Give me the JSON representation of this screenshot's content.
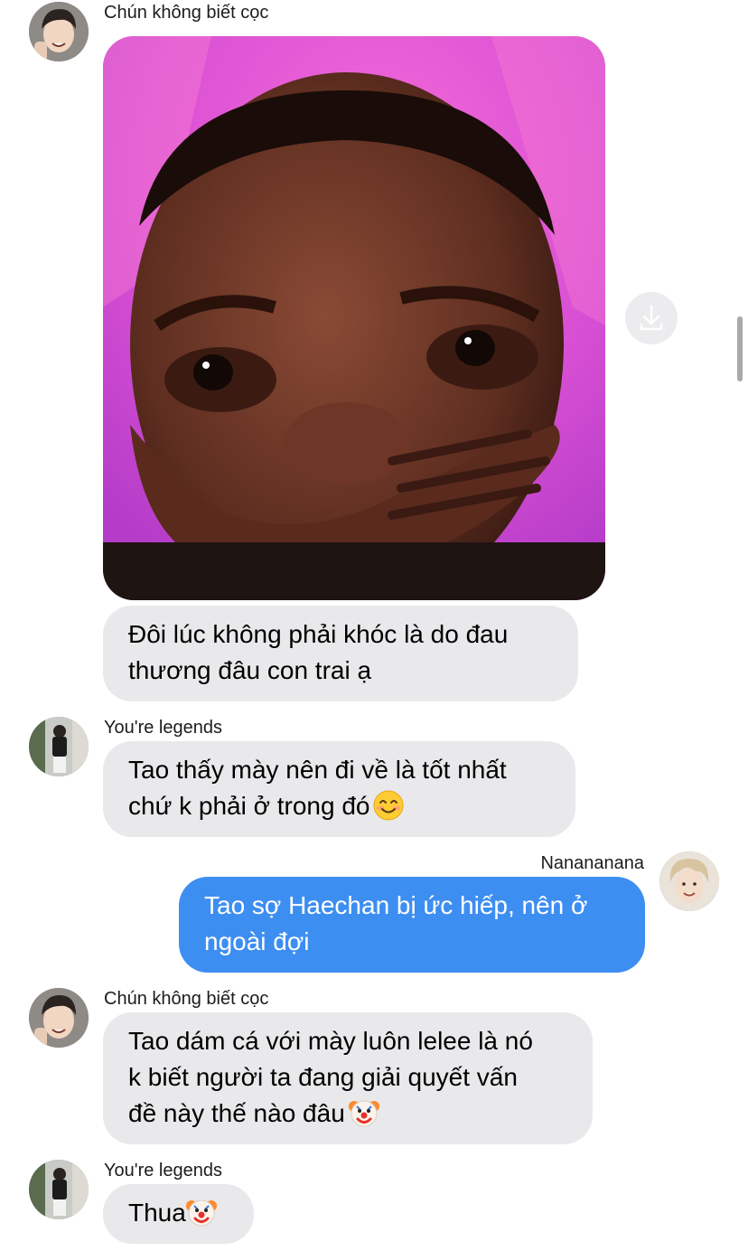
{
  "messages": [
    {
      "sender": "Chún không biết cọc",
      "image_alt": "meme-photo",
      "text": "Đôi lúc không phải khóc là do đau thương đâu con trai ạ",
      "line1": "Đôi lúc không phải khóc là do đau",
      "line2": "thương đâu con trai ạ"
    },
    {
      "sender": "You're legends",
      "line1": "Tao thấy mày nên đi về là tốt nhất",
      "line2": "chứ k phải ở trong đó",
      "emoji": "smiling-face"
    },
    {
      "sender": "Nanananana",
      "line1": "Tao sợ Haechan bị ức hiếp, nên ở",
      "line2": "ngoài đợi"
    },
    {
      "sender": "Chún không biết cọc",
      "line1": "Tao dám cá với mày luôn lelee là nó",
      "line2": "k biết người ta đang giải quyết vấn",
      "line3": "đề này thế nào đâu",
      "emoji": "clown-face"
    },
    {
      "sender": "You're legends",
      "line1": "Thua",
      "emoji": "clown-face"
    }
  ],
  "icons": {
    "download": "download-icon",
    "smiling_emoji": "smiling-face-emoji",
    "clown_emoji": "clown-face-emoji"
  },
  "colors": {
    "incoming_bubble": "#e9e9eb",
    "outgoing_bubble": "#3d8ef1",
    "photo_background": "#d94fd6"
  }
}
